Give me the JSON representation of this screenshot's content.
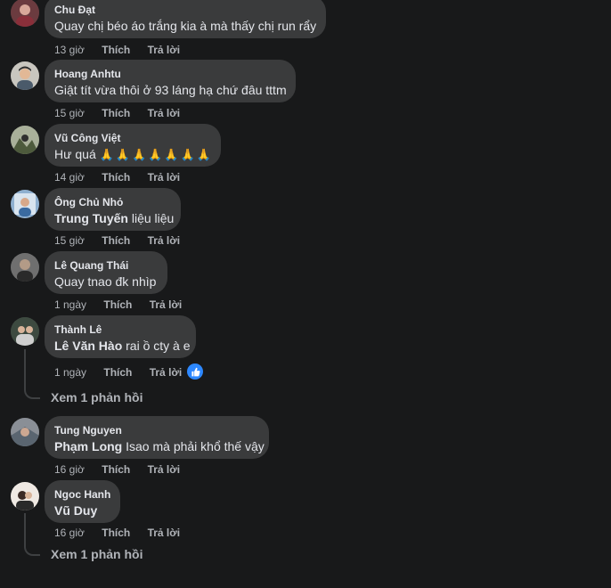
{
  "comments": [
    {
      "author": "Chu Đạt",
      "tag": "",
      "text": "Quay chị béo áo trắng kia à mà thấy chị run rẩy",
      "time": "13 giờ",
      "like": "Thích",
      "reply": "Trả lời"
    },
    {
      "author": "Hoang Anhtu",
      "tag": "",
      "text": "Giật tít vừa thôi ở 93 láng hạ chứ đâu tttm",
      "time": "15 giờ",
      "like": "Thích",
      "reply": "Trả lời"
    },
    {
      "author": "Vũ Công Việt",
      "tag": "",
      "text": "Hư quá",
      "emoji": "🙏🙏🙏🙏🙏🙏🙏",
      "time": "14 giờ",
      "like": "Thích",
      "reply": "Trả lời"
    },
    {
      "author": "Ông Chủ Nhỏ",
      "tag": "Trung Tuyến",
      "text": "liệu liệu",
      "time": "15 giờ",
      "like": "Thích",
      "reply": "Trả lời"
    },
    {
      "author": "Lê Quang Thái",
      "tag": "",
      "text": "Quay tnao đk nhìp",
      "time": "1 ngày",
      "like": "Thích",
      "reply": "Trả lời"
    },
    {
      "author": "Thành Lê",
      "tag": "Lê Văn Hào",
      "text": "rai ồ cty à e",
      "time": "1 ngày",
      "like": "Thích",
      "reply": "Trả lời",
      "replies": "Xem 1 phản hồi"
    },
    {
      "author": "Tung Nguyen",
      "tag": "Phạm Long",
      "text": "Isao mà phải khổ thế vậy",
      "time": "16 giờ",
      "like": "Thích",
      "reply": "Trả lời"
    },
    {
      "author": "Ngoc Hanh",
      "tag": "Vũ Duy",
      "text": "",
      "time": "16 giờ",
      "like": "Thích",
      "reply": "Trả lời",
      "replies": "Xem 1 phản hồi"
    }
  ],
  "colors": {
    "background": "#18191a",
    "bubble": "#3a3b3c",
    "text": "#e4e6eb",
    "muted": "#b0b3b8",
    "like_reaction": "#2d88ff"
  },
  "icons": {
    "reaction": "like-thumb-icon"
  }
}
